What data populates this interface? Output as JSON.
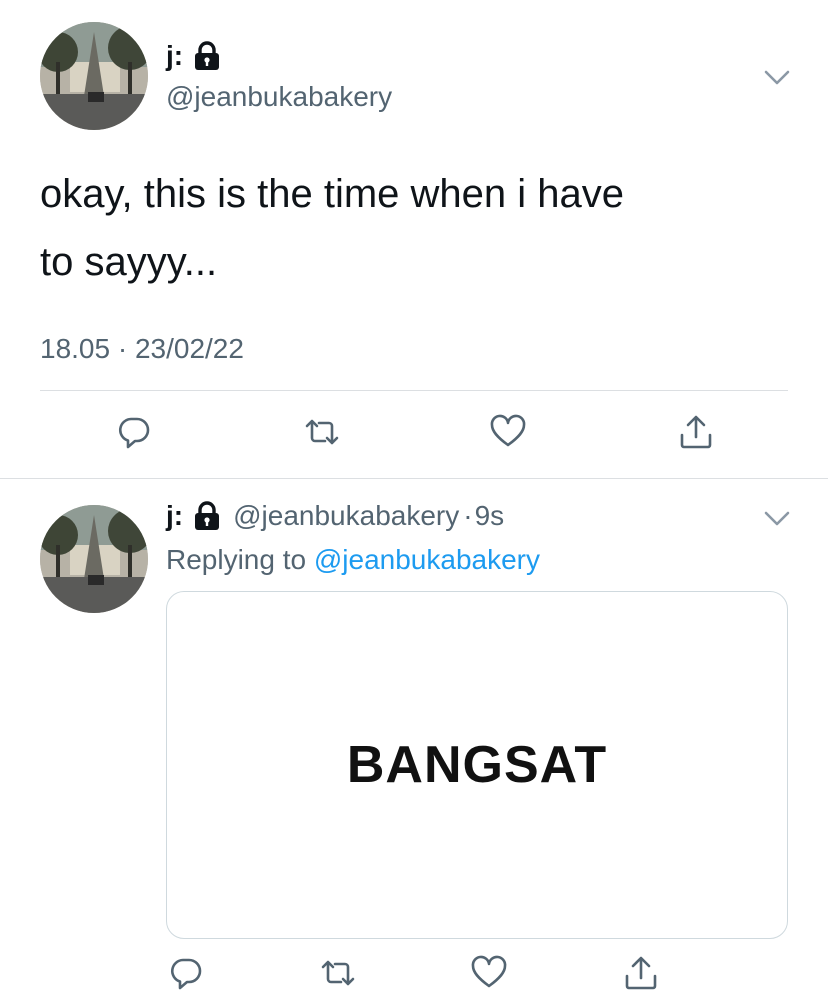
{
  "tweet": {
    "display_name": "j:",
    "handle": "@jeanbukabakery",
    "text_line1": "okay, this is the time when i have",
    "text_line2": "to sayyy...",
    "timestamp": "18.05 · 23/02/22",
    "icons": {
      "lock": "lock-icon",
      "more": "chevron-down-icon",
      "reply": "reply-icon",
      "retweet": "retweet-icon",
      "like": "heart-icon",
      "share": "share-icon"
    }
  },
  "reply": {
    "display_name": "j:",
    "handle": "@jeanbukabakery",
    "separator": "·",
    "age": "9s",
    "replying_to_prefix": "Replying to",
    "replying_to_handle": "@jeanbukabakery",
    "card_text": "BANGSAT"
  },
  "colors": {
    "text": "#0f1419",
    "secondary": "#536471",
    "link": "#1d9bf0",
    "divider": "#dcdfe2"
  }
}
